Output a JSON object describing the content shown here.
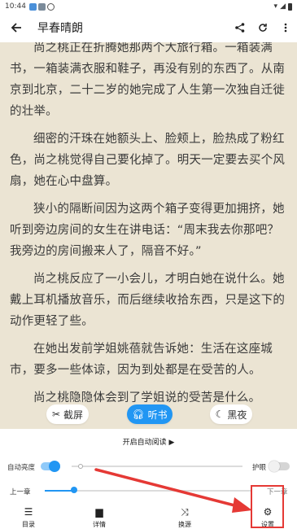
{
  "status_bar": {
    "time": "10:44"
  },
  "app_bar": {
    "title": "早春晴朗",
    "back_icon": "arrow-left-icon",
    "share_icon": "share-icon",
    "refresh_icon": "refresh-icon",
    "more_icon": "more-vert-icon"
  },
  "content": {
    "paragraphs": [
      "尚之桃正在折腾她那两个大旅行箱。一箱装满书，一箱装满衣服和鞋子，再没有别的东西了。从南京到北京，二十二岁的她完成了人生第一次独自迁徙的壮举。",
      "细密的汗珠在她额头上、脸颊上，脸热成了粉红色，尚之桃觉得自己要化掉了。明天一定要去买个风扇，她在心中盘算。",
      "狭小的隔断间因为这两个箱子变得更加拥挤，她听到旁边房间的女生在讲电话：“周末我去你那吧？我旁边的房间搬来人了，隔音不好。”",
      "尚之桃反应了一小会儿，才明白她在说什么。她戴上耳机播放音乐，而后继续收拾东西，只是这下的动作更轻了些。",
      "在她出发前学姐姚蓓就告诉她：生活在这座城市，要多一些体谅，因为到处都是在受苦的人。",
      "尚之桃隐隐体会到了学姐说的受苦是什么。"
    ]
  },
  "floating": {
    "screenshot_label": "截屏",
    "listen_label": "听书",
    "night_label": "黑夜"
  },
  "panel": {
    "auto_read_label": "开启自动阅读 ▶",
    "brightness_label": "自动亮度",
    "eye_care_label": "护眼",
    "brightness_level": 0.05,
    "prev_chapter_label": "上一章",
    "next_chapter_label": "下一章",
    "chapter_progress": 0.14,
    "nav": [
      {
        "label": "目录",
        "icon": "list-icon"
      },
      {
        "label": "详情",
        "icon": "comment-icon"
      },
      {
        "label": "换源",
        "icon": "shuffle-icon"
      },
      {
        "label": "设置",
        "icon": "gear-icon"
      }
    ]
  },
  "colors": {
    "accent": "#2196f3",
    "page_background": "#ebe4d3",
    "annotation": "#e53935"
  }
}
